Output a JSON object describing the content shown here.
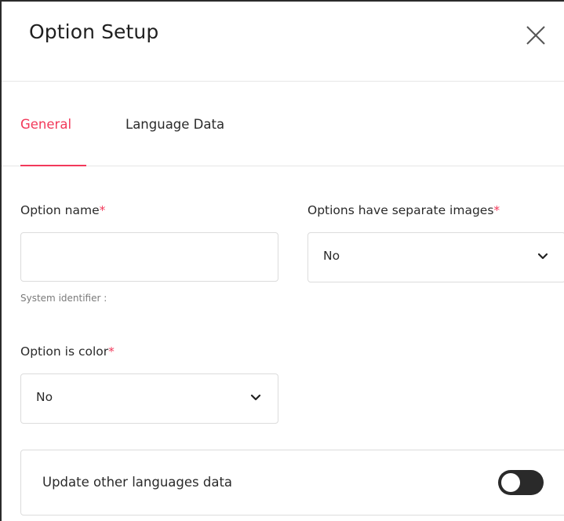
{
  "header": {
    "title": "Option Setup"
  },
  "tabs": [
    {
      "label": "General",
      "active": true
    },
    {
      "label": "Language Data",
      "active": false
    }
  ],
  "form": {
    "option_name": {
      "label": "Option name",
      "required_mark": "*",
      "value": "",
      "hint": "System identifier :"
    },
    "separate_images": {
      "label": "Options have separate images",
      "required_mark": "*",
      "selected": "No"
    },
    "is_color": {
      "label": "Option is color",
      "required_mark": "*",
      "selected": "No"
    },
    "update_languages": {
      "label": "Update other languages data",
      "enabled": false
    }
  },
  "colors": {
    "accent": "#f2395a",
    "toggle_off": "#2a2a2a"
  },
  "icons": {
    "close": "close-icon",
    "dropdown": "chevron-down-icon"
  }
}
